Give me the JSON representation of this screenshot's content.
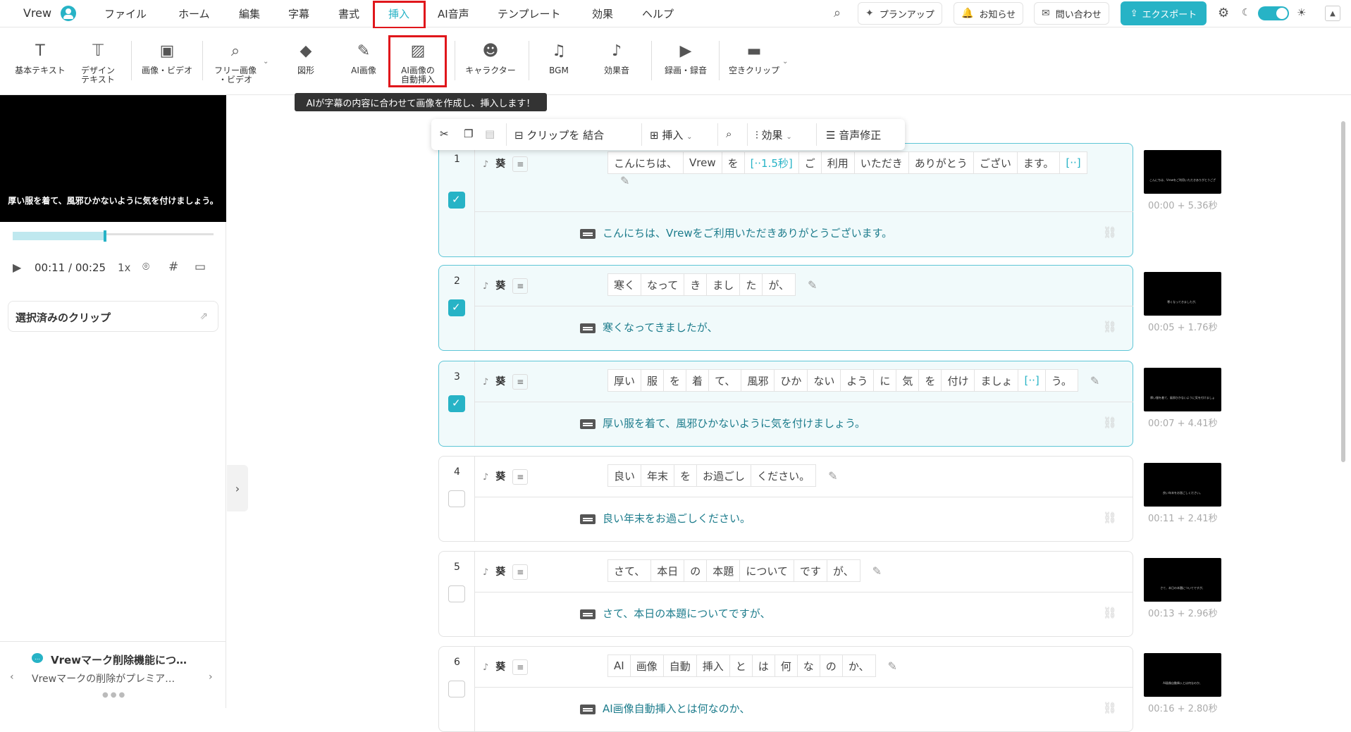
{
  "app": {
    "name": "Vrew"
  },
  "menu": {
    "items": [
      {
        "label": "ファイル"
      },
      {
        "label": "ホーム"
      },
      {
        "label": "編集"
      },
      {
        "label": "字幕"
      },
      {
        "label": "書式"
      },
      {
        "label": "挿入"
      },
      {
        "label": "AI音声"
      },
      {
        "label": "テンプレート"
      },
      {
        "label": "効果"
      },
      {
        "label": "ヘルプ"
      }
    ],
    "active": "挿入"
  },
  "topright": {
    "plan": "プランアップ",
    "notice": "お知らせ",
    "contact": "問い合わせ",
    "export": "エクスポート"
  },
  "toolbar": {
    "items": [
      {
        "label": "基本テキスト",
        "icon": "text-icon"
      },
      {
        "label": "デザイン\nテキスト",
        "icon": "design-text-icon"
      },
      {
        "label": "画像・ビデオ",
        "icon": "image-video-icon"
      },
      {
        "label": "フリー画像\n・ビデオ",
        "icon": "free-image-icon"
      },
      {
        "label": "図形",
        "icon": "shapes-icon"
      },
      {
        "label": "AI画像",
        "icon": "ai-image-icon"
      },
      {
        "label": "AI画像の\n自動挿入",
        "icon": "ai-image-auto-icon"
      },
      {
        "label": "キャラクター",
        "icon": "character-icon"
      },
      {
        "label": "BGM",
        "icon": "music-icon"
      },
      {
        "label": "効果音",
        "icon": "sound-effect-icon"
      },
      {
        "label": "録画・録音",
        "icon": "record-icon"
      },
      {
        "label": "空きクリップ",
        "icon": "empty-clip-icon"
      }
    ],
    "tooltip": "AIが字幕の内容に合わせて画像を作成し、挿入します！"
  },
  "player": {
    "caption": "厚い服を着て、風邪ひかないように気を付けましょう。",
    "current": "00:11",
    "total": "/ 00:25",
    "speed": "1x",
    "progress": 0.46
  },
  "selected_clip": {
    "label": "選択済みのクリップ"
  },
  "news": {
    "title": "Vrewマーク削除機能につ…",
    "body": "Vrewマークの削除がプレミア…"
  },
  "clip_toolbar": {
    "merge": "クリップを 結合",
    "insert": "挿入",
    "effect": "効果",
    "voice": "音声修正"
  },
  "clips": [
    {
      "num": "1",
      "speaker": "葵",
      "words": [
        "こんにちは、",
        "Vrew",
        "を",
        "[··1.5秒]",
        "ご",
        "利用",
        "いただき",
        "ありがとう",
        "ござい",
        "ます。",
        "[··]"
      ],
      "subtitle": "こんにちは、Vrewをご利用いただきありがとうございます。",
      "time": "00:00 + 5.36秒",
      "thumb": "こんにちは、Vrewをご利用いただきありがとうございます。",
      "selected": true
    },
    {
      "num": "2",
      "speaker": "葵",
      "words": [
        "寒く",
        "なって",
        "き",
        "まし",
        "た",
        "が、"
      ],
      "subtitle": "寒くなってきましたが、",
      "time": "00:05 + 1.76秒",
      "thumb": "寒くなってきましたが、",
      "selected": true
    },
    {
      "num": "3",
      "speaker": "葵",
      "words": [
        "厚い",
        "服",
        "を",
        "着",
        "て、",
        "風邪",
        "ひか",
        "ない",
        "よう",
        "に",
        "気",
        "を",
        "付け",
        "ましょ",
        "[··]",
        "う。"
      ],
      "subtitle": "厚い服を着て、風邪ひかないように気を付けましょう。",
      "time": "00:07 + 4.41秒",
      "thumb": "厚い服を着て、風邪ひかないように気を付けましょう。",
      "selected": true
    },
    {
      "num": "4",
      "speaker": "葵",
      "words": [
        "良い",
        "年末",
        "を",
        "お過ごし",
        "ください。"
      ],
      "subtitle": "良い年末をお過ごしください。",
      "time": "00:11 + 2.41秒",
      "thumb": "良い年末をお過ごしください。",
      "selected": false
    },
    {
      "num": "5",
      "speaker": "葵",
      "words": [
        "さて、",
        "本日",
        "の",
        "本題",
        "について",
        "です",
        "が、"
      ],
      "subtitle": "さて、本日の本題についてですが、",
      "time": "00:13 + 2.96秒",
      "thumb": "さて、本日の本題についてですが、",
      "selected": false
    },
    {
      "num": "6",
      "speaker": "葵",
      "words": [
        "AI",
        "画像",
        "自動",
        "挿入",
        "と",
        "は",
        "何",
        "な",
        "の",
        "か、"
      ],
      "subtitle": "AI画像自動挿入とは何なのか、",
      "time": "00:16 + 2.80秒",
      "thumb": "AI画像自動挿入とは何なのか、",
      "selected": false
    }
  ]
}
